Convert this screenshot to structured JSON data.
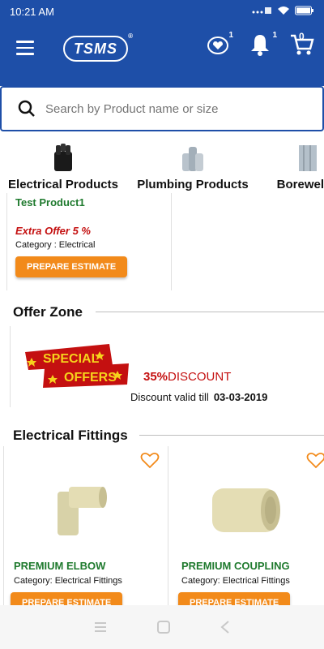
{
  "status": {
    "time": "10:21 AM",
    "battery": "battery"
  },
  "header": {
    "logo_text": "TSMS",
    "wishlist_count": "1",
    "cart_count": "0"
  },
  "search": {
    "placeholder": "Search by Product name or size"
  },
  "categories": [
    {
      "label": "Electrical Products"
    },
    {
      "label": "Plumbing Products"
    },
    {
      "label": "Borewell P"
    }
  ],
  "featured": {
    "name": "Test Product1",
    "offer": "Extra Offer  5   %",
    "category": "Category : Electrical",
    "button": "PREPARE ESTIMATE"
  },
  "offer_zone": {
    "title": "Offer Zone",
    "banner_top": "SPECIAL",
    "banner_bottom": "OFFERS",
    "discount_value": "35%",
    "discount_label": "DISCOUNT",
    "valid_label": "Discount valid till",
    "valid_date": "03-03-2019"
  },
  "electrical_fittings": {
    "title": "Electrical Fittings",
    "products": [
      {
        "name": "PREMIUM ELBOW",
        "category": "Category: Electrical Fittings",
        "button": "PREPARE ESTIMATE"
      },
      {
        "name": "PREMIUM COUPLING",
        "category": "Category: Electrical Fittings",
        "button": "PREPARE ESTIMATE"
      }
    ]
  },
  "colors": {
    "primary": "#1e4fa8",
    "accent": "#f28a1a",
    "green": "#1f7a2e",
    "red": "#c41010"
  }
}
